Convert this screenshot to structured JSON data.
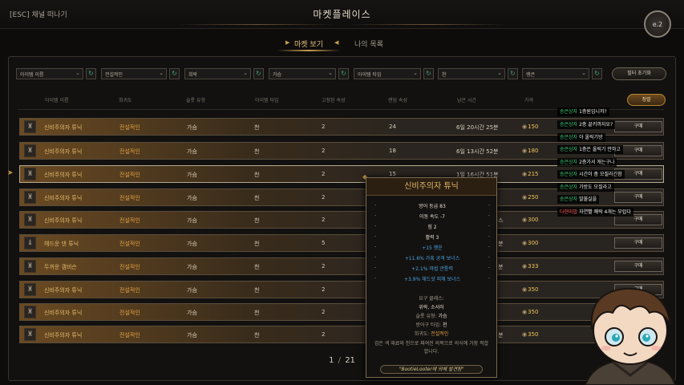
{
  "topbar": {
    "esc_label": "[ESC] 채널 떠나기",
    "title": "마켓플레이스",
    "badge": "e.2"
  },
  "tabs": {
    "active": "마켓 보기",
    "inactive": "나의 목록"
  },
  "filters": [
    {
      "label": "아이템 이름"
    },
    {
      "label": "전설적인"
    },
    {
      "label": "희락"
    },
    {
      "label": "가슴"
    },
    {
      "label": "아이템 타입"
    },
    {
      "label": "천"
    },
    {
      "label": "랭큰"
    }
  ],
  "reset_label": "필터 초기화",
  "sort_label": "정렬",
  "headers": [
    "아이템 이름",
    "희귀도",
    "슬롯 유형",
    "아이템 타입",
    "고정된 속성",
    "랜덤 속성",
    "남은 시간",
    "가격"
  ],
  "rows": [
    {
      "name": "신비주의자 튜닉",
      "rarity": "전설적인",
      "slot": "가슴",
      "type": "천",
      "fixed": "2",
      "random": "24",
      "time": "6일 20시간 25분",
      "price": "150"
    },
    {
      "name": "신비주의자 튜닉",
      "rarity": "전설적인",
      "slot": "가슴",
      "type": "천",
      "fixed": "2",
      "random": "18",
      "time": "6일 13시간 52분",
      "price": "180"
    },
    {
      "name": "신비주의자 튜닉",
      "rarity": "전설적인",
      "slot": "가슴",
      "type": "천",
      "fixed": "2",
      "random": "15",
      "time": "1일 16시간 51분",
      "price": "215"
    },
    {
      "name": "신비주의자 튜닉",
      "rarity": "전설적인",
      "slot": "가슴",
      "type": "천",
      "fixed": "2",
      "random": "",
      "time": "",
      "price": "250"
    },
    {
      "name": "신비주의자 튜닉",
      "rarity": "전설적인",
      "slot": "가슴",
      "type": "천",
      "fixed": "2",
      "random": "",
      "time": "스",
      "price": "300"
    },
    {
      "name": "헤드운 댄 튜닉",
      "rarity": "전설적인",
      "slot": "가슴",
      "type": "천",
      "fixed": "5",
      "random": "",
      "time": "분",
      "price": "300"
    },
    {
      "name": "두꺼운 갬비슨",
      "rarity": "전설적인",
      "slot": "가슴",
      "type": "천",
      "fixed": "2",
      "random": "",
      "time": "분",
      "price": "333"
    },
    {
      "name": "신비주의자 튜닉",
      "rarity": "전설적인",
      "slot": "가슴",
      "type": "천",
      "fixed": "2",
      "random": "",
      "time": "",
      "price": "350"
    },
    {
      "name": "신비주의자 튜닉",
      "rarity": "전설적인",
      "slot": "가슴",
      "type": "천",
      "fixed": "2",
      "random": "",
      "time": "",
      "price": "350"
    },
    {
      "name": "신비주의자 튜닉",
      "rarity": "전설적인",
      "slot": "가슴",
      "type": "천",
      "fixed": "2",
      "random": "",
      "time": "분",
      "price": "350"
    }
  ],
  "buy_label": "구매",
  "pager": {
    "current": "1",
    "sep": "/",
    "total": "21"
  },
  "tooltip": {
    "title": "신비주의자 튜닉",
    "stats": [
      "방어 등급 83",
      "이동 속도 -7",
      "힘 2",
      "활력 3"
    ],
    "random_stats": [
      "+15 행운",
      "+11.6% 가혹 공격 보너스",
      "+2.1% 마법 관통력",
      "+3.9% 헤드샷 피해 보너스"
    ],
    "req_label": "요구 클래스:",
    "req_value": "위락, 소서러",
    "slot_label": "슬롯 유형:",
    "slot_value": "가슴",
    "type_label": "방어구 타입:",
    "type_value": "천",
    "rarity_label": "희귀도:",
    "rarity_value": "전설적인",
    "desc": "검은 색 재료와 천으로 짜여진 의복으로 의식에 가장 적합합니다.",
    "footer": "\"BootieLooter에 의해 발견됨\""
  },
  "chat": [
    {
      "nick": "승은상자",
      "msg": "1층원입니까?",
      "red": false
    },
    {
      "nick": "승은상자",
      "msg": "2층 끝키까지요?",
      "red": false
    },
    {
      "nick": "승은상자",
      "msg": "아 올릭기방",
      "red": false
    },
    {
      "nick": "승은상자",
      "msg": "1층은 올릭기 만하고",
      "red": false
    },
    {
      "nick": "승은상자",
      "msg": "2층가서 캐는구나",
      "red": false
    },
    {
      "nick": "승은상자",
      "msg": "시간이 좀 모질라긴함",
      "red": false
    },
    {
      "nick": "승은상자",
      "msg": "가방도 모질라고",
      "red": false
    },
    {
      "nick": "승은상자",
      "msg": "말불실을",
      "red": false
    },
    {
      "nick": "다현미밥",
      "msg": "자연빨 쾌락 4개는 부럽다",
      "red": true
    }
  ]
}
